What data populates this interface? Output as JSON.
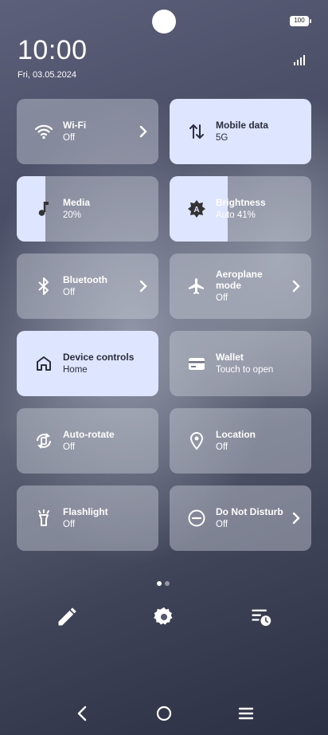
{
  "status": {
    "battery": "100",
    "time": "10:00",
    "date": "Fri, 03.05.2024"
  },
  "tiles": [
    {
      "title": "Wi-Fi",
      "sub": "Off",
      "icon": "wifi-icon",
      "active": false,
      "chevron": true
    },
    {
      "title": "Mobile data",
      "sub": "5G",
      "icon": "mobile-data-icon",
      "active": true,
      "chevron": false
    },
    {
      "title": "Media",
      "sub": "20%",
      "icon": "music-note-icon",
      "level": 0.2
    },
    {
      "title": "Brightness",
      "sub": "Auto 41%",
      "icon": "brightness-auto-icon",
      "level": 0.41
    },
    {
      "title": "Bluetooth",
      "sub": "Off",
      "icon": "bluetooth-icon",
      "active": false,
      "chevron": true
    },
    {
      "title": "Aeroplane mode",
      "title_line1": "Aeroplane",
      "title_line2": "mode",
      "sub": "Off",
      "icon": "airplane-icon",
      "active": false,
      "chevron": true
    },
    {
      "title": "Device controls",
      "sub": "Home",
      "icon": "home-icon",
      "active": true,
      "chevron": false
    },
    {
      "title": "Wallet",
      "sub": "Touch to open",
      "icon": "wallet-icon",
      "active": false,
      "chevron": false
    },
    {
      "title": "Auto-rotate",
      "sub": "Off",
      "icon": "auto-rotate-icon",
      "active": false,
      "chevron": false
    },
    {
      "title": "Location",
      "sub": "Off",
      "icon": "location-pin-icon",
      "active": false,
      "chevron": false
    },
    {
      "title": "Flashlight",
      "sub": "Off",
      "icon": "flashlight-icon",
      "active": false,
      "chevron": false
    },
    {
      "title": "Do Not Disturb",
      "sub": "Off",
      "icon": "do-not-disturb-icon",
      "active": false,
      "chevron": true
    }
  ],
  "pager": {
    "current": 1,
    "total": 2
  },
  "bottom_actions": [
    "edit-icon",
    "settings-gear-icon",
    "history-clock-icon"
  ],
  "nav": [
    "back-icon",
    "home-circle-icon",
    "menu-icon"
  ],
  "colors": {
    "active_tile": "#dde5ff",
    "inactive_tile": "rgba(200,205,215,0.45)"
  }
}
